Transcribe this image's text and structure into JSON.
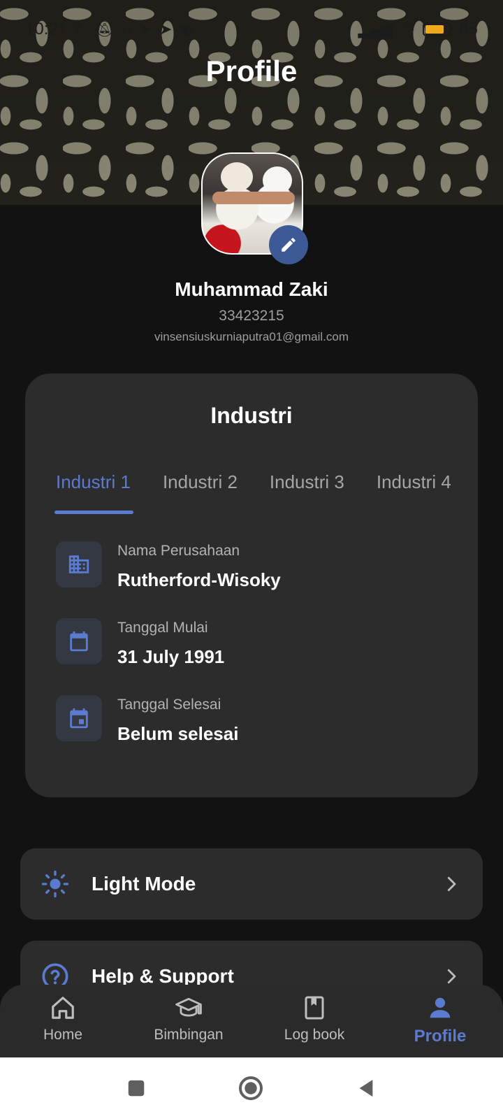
{
  "status_bar": {
    "time": "10:21",
    "battery": "85"
  },
  "header": {
    "title": "Profile"
  },
  "profile": {
    "name": "Muhammad Zaki",
    "id": "33423215",
    "email": "vinsensiuskurniaputra01@gmail.com"
  },
  "industry_card": {
    "title": "Industri",
    "tabs": [
      {
        "label": "Industri 1",
        "active": true
      },
      {
        "label": "Industri 2",
        "active": false
      },
      {
        "label": "Industri 3",
        "active": false
      },
      {
        "label": "Industri 4",
        "active": false
      }
    ],
    "fields": [
      {
        "label": "Nama Perusahaan",
        "value": "Rutherford-Wisoky",
        "icon": "building-icon"
      },
      {
        "label": "Tanggal Mulai",
        "value": "31 July 1991",
        "icon": "calendar-icon"
      },
      {
        "label": "Tanggal Selesai",
        "value": "Belum selesai",
        "icon": "calendar-event-icon"
      }
    ]
  },
  "settings": [
    {
      "label": "Light Mode",
      "icon": "sun-icon"
    },
    {
      "label": "Help & Support",
      "icon": "help-icon"
    }
  ],
  "bottom_nav": [
    {
      "label": "Home",
      "icon": "home-icon",
      "active": false
    },
    {
      "label": "Bimbingan",
      "icon": "graduation-cap-icon",
      "active": false
    },
    {
      "label": "Log book",
      "icon": "book-icon",
      "active": false
    },
    {
      "label": "Profile",
      "icon": "person-icon",
      "active": true
    }
  ],
  "colors": {
    "accent": "#5b7bd0",
    "background": "#121212",
    "card": "#2c2c2c"
  }
}
